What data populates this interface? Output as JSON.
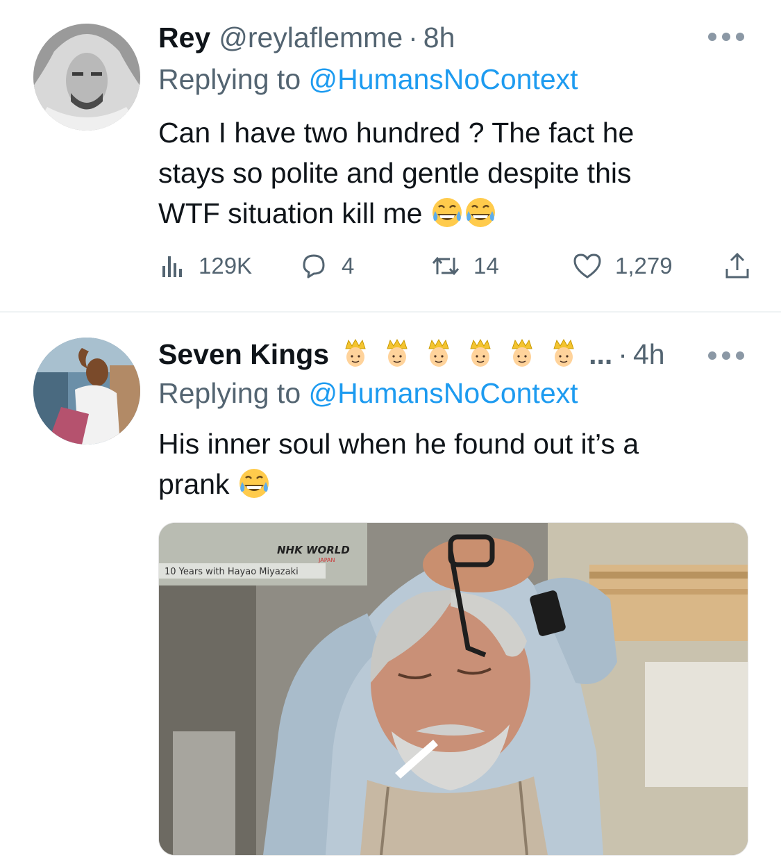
{
  "tweets": [
    {
      "display_name": "Rey",
      "handle": "@reylaflemme",
      "separator": "·",
      "time": "8h",
      "replying_prefix": "Replying to ",
      "replying_to": "@HumansNoContext",
      "text_lines": [
        "Can I have two hundred ? The fact he",
        "stays so polite and gentle despite this",
        "WTF situation kill me"
      ],
      "emoji": [
        "face-with-tears-of-joy",
        "face-with-tears-of-joy"
      ],
      "stats": {
        "views": "129K",
        "replies": "4",
        "retweets": "14",
        "likes": "1,279"
      }
    },
    {
      "display_name": "Seven Kings",
      "name_emoji": [
        "person-with-crown",
        "person-with-crown",
        "person-with-crown",
        "person-with-crown",
        "person-with-crown",
        "person-with-crown"
      ],
      "ellipsis": "...",
      "separator": "·",
      "time": "4h",
      "replying_prefix": "Replying to ",
      "replying_to": "@HumansNoContext",
      "text_lines": [
        "His inner soul when he found out it’s a",
        "prank"
      ],
      "emoji": [
        "face-with-tears-of-joy"
      ],
      "media": {
        "overlay_logo": "NHK WORLD",
        "overlay_sub": "JAPAN",
        "overlay_caption": "10 Years with Hayao Miyazaki"
      }
    }
  ],
  "colors": {
    "text": "#0f1419",
    "secondary": "#536471",
    "link": "#1d9bf0",
    "divider": "#eff3f4"
  }
}
